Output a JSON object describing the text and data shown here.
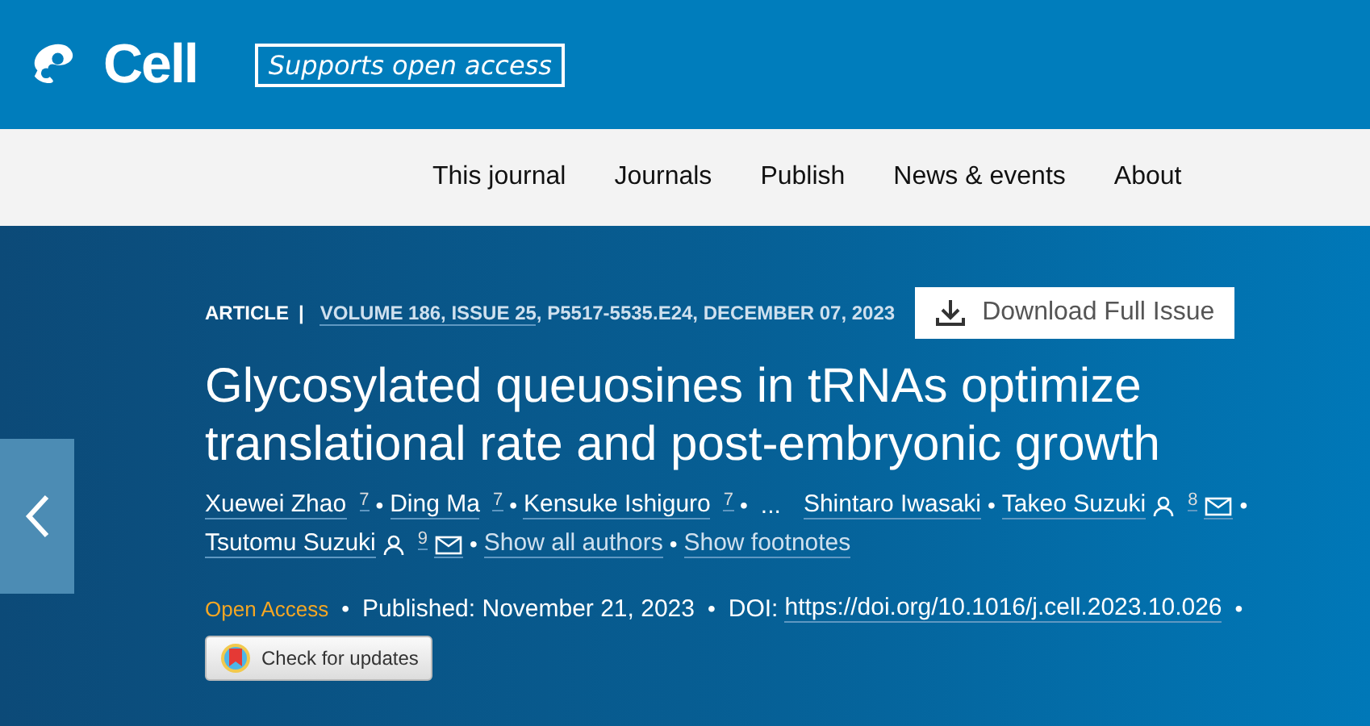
{
  "header": {
    "logo": "Cell",
    "tagline": "Supports open access"
  },
  "nav": [
    "This journal",
    "Journals",
    "Publish",
    "News & events",
    "About"
  ],
  "article": {
    "type": "ARTICLE",
    "type_separator": "|",
    "citation_link": "VOLUME 186, ISSUE 25",
    "citation_rest": ", P5517-5535.E24, DECEMBER 07, 2023",
    "download": "Download Full Issue",
    "title": "Glycosylated queuosines in tRNAs optimize translational rate and post-embryonic growth",
    "authors": [
      {
        "kind": "author",
        "name": "Xuewei Zhao",
        "sup": "7",
        "corresponding": false,
        "bullet": "•"
      },
      {
        "kind": "author",
        "name": "Ding Ma",
        "sup": "7",
        "corresponding": false,
        "bullet": "•"
      },
      {
        "kind": "author",
        "name": "Kensuke Ishiguro",
        "sup": "7",
        "corresponding": false,
        "bullet": "•"
      },
      {
        "kind": "ellipsis",
        "name": "..."
      },
      {
        "kind": "author",
        "name": "Shintaro Iwasaki",
        "corresponding": false,
        "bullet": "•"
      },
      {
        "kind": "author",
        "name": "Takeo Suzuki",
        "sup": "8",
        "corresponding": true,
        "bullet": "•"
      },
      {
        "kind": "author",
        "name": "Tsutomu Suzuki",
        "sup": "9",
        "corresponding": true,
        "bullet": "•"
      },
      {
        "kind": "link",
        "name": "Show all authors",
        "bullet": "•"
      },
      {
        "kind": "link",
        "name": "Show footnotes"
      }
    ],
    "access": "Open Access",
    "access_bullet": "•",
    "published": "Published: November 21, 2023",
    "published_bullet": "•",
    "doi_label": "DOI:",
    "doi": "https://doi.org/10.1016/j.cell.2023.10.026",
    "doi_bullet": "•",
    "check": "Check for updates"
  }
}
